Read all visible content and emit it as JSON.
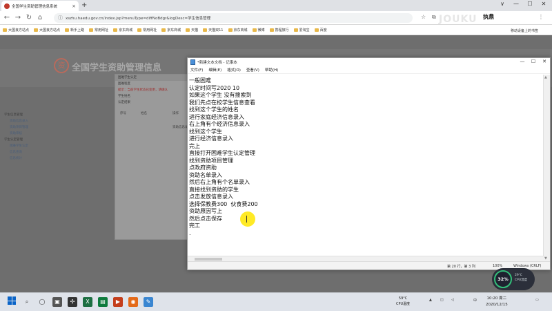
{
  "browser": {
    "tab_title": "全国学生资助管理信息系统",
    "tab_close": "×",
    "new_tab": "+",
    "window_controls": [
      "∨",
      "—",
      "☐",
      "✕"
    ],
    "url": "xszhu.haedu.gov.cn/index.jsp?menuType=diffNoBdgr&logDesc=学生信息管理",
    "profile_label": "执鼎",
    "bookmarks": [
      "大国良方站点",
      "大国良方站点",
      "新手上路",
      "常用网址",
      "京东商城",
      "常用网址",
      "京东商城",
      "天猫",
      "天猫双11",
      "京东商城",
      "微博",
      "携程旅行",
      "爱淘宝",
      "百度"
    ],
    "bookmark_right": "移动设备上的书签"
  },
  "page": {
    "site_title": "全国学生资助管理信息",
    "logo_char": "资",
    "dialog_title": "困难学生认定",
    "dialog_rows": [
      "困难程度",
      "学生姓名",
      "认定结果"
    ],
    "dialog_warning": "提示：当前学生状态已变更，请确认",
    "left_tree": [
      "学生信息管理",
      "资助信息录入",
      "资助项目管理",
      "资助审核",
      "学生认定管理",
      "困难学生认定",
      "信息查询",
      "信息统计"
    ],
    "bg_labels": [
      "序号",
      "姓名",
      "操作",
      "资助信息录入"
    ]
  },
  "notepad": {
    "title": "*新建文本文档 - 记事本",
    "menu": [
      "文件(F)",
      "编辑(E)",
      "格式(O)",
      "查看(V)",
      "帮助(H)"
    ],
    "lines": [
      "一般困难",
      "认定时间写2020 10",
      "如果这个学生 没有搜索到",
      "我们先点在校学生信息查看",
      "找到这个学生的姓名",
      "进行家庭经济信息录入",
      "右上角有个经济信息录入",
      "找到这个学生",
      "进行经济信息录入",
      "完上",
      "直接打开困难学生认定管理",
      "找到资助项目管理",
      "点政府资助",
      "资助名单录入",
      "然后右上角有个名单录入",
      "直接找到资助的学生",
      "点击发放信息录入",
      "选择保教费300  伙食费200",
      "资助原因写上",
      "然后点击保存",
      "完工",
      "."
    ],
    "status_position": "第 20 行，第 3 列",
    "status_zoom": "100%",
    "status_eol": "Windows (CRLF)"
  },
  "overlay": {
    "watermark": "JOUKU",
    "perf_percent": "32%",
    "perf_line1": "29℃",
    "perf_line2": "CPU温度"
  },
  "taskbar": {
    "weather_temp": "59°C",
    "weather_label": "CPU温度",
    "time": "10:20 周二",
    "date": "2020/12/15",
    "tray_ime": "中"
  }
}
